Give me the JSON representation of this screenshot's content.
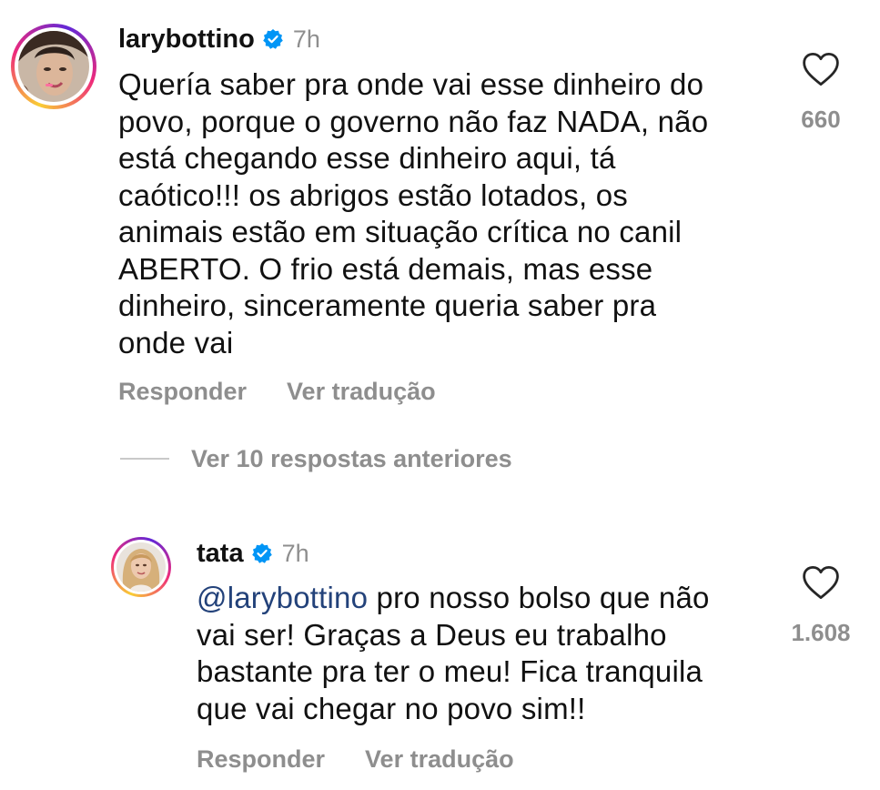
{
  "comments": [
    {
      "username": "larybottino",
      "verified_icon": "verified-badge-icon",
      "time": "7h",
      "lines": [
        "Quería saber pra onde vai esse dinheiro do",
        "povo, porque o governo não faz NADA, não",
        "está chegando esse dinheiro aqui, tá",
        "caótico!!! os abrigos estão lotados, os",
        "animais estão em situação crítica no canil",
        "ABERTO. O frio está demais, mas esse",
        "dinheiro, sinceramente queria saber pra",
        "onde vai"
      ],
      "likes": "660",
      "reply_label": "Responder",
      "translate_label": "Ver tradução"
    },
    {
      "username": "tata",
      "verified_icon": "verified-badge-icon",
      "time": "7h",
      "mention": "@larybottino",
      "lines": [
        " pro nosso bolso que não",
        "vai ser! Graças a Deus eu trabalho",
        "bastante pra ter o meu! Fica tranquila",
        "que vai chegar no povo sim!!"
      ],
      "likes": "1.608",
      "reply_label": "Responder",
      "translate_label": "Ver tradução"
    }
  ],
  "view_replies_label": "Ver 10 respostas anteriores",
  "colors": {
    "text": "#111111",
    "secondary": "#8e8e8e",
    "mention": "#23427a",
    "verified": "#0095f6"
  }
}
